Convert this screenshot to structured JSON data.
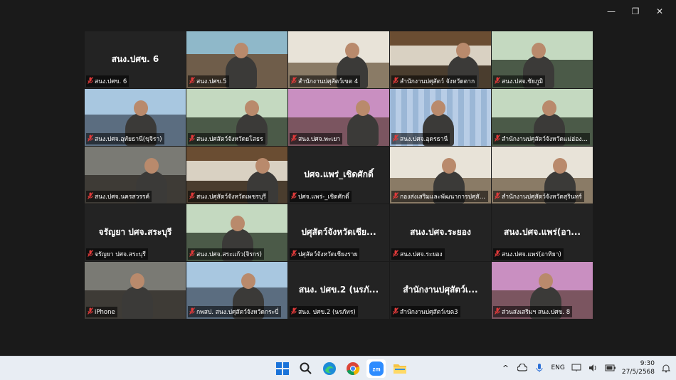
{
  "window": {
    "controls": {
      "minimize": "—",
      "restore": "❐",
      "close": "✕"
    }
  },
  "tiles": [
    {
      "big": "สนง.ปศข. 6",
      "label": "สนง.ปศข. 6",
      "scene": ""
    },
    {
      "big": "",
      "label": "สนง.ปศข.5",
      "scene": "scene-room"
    },
    {
      "big": "",
      "label": "สำนักงานปศุสัตว์เขต 4",
      "scene": "scene-office"
    },
    {
      "big": "",
      "label": "สำนักงานปศุสัตว์ จังหวัดตาก",
      "scene": "scene-board"
    },
    {
      "big": "",
      "label": "สนง.ปสจ.ชัยภูมิ",
      "scene": "scene-green"
    },
    {
      "big": "",
      "label": "สนง.ปศจ.อุทัยธานี(ขุจิรา)",
      "scene": "scene-blue"
    },
    {
      "big": "",
      "label": "สนง.ปศสัตว์จังหวัดยโสธร",
      "scene": "scene-green"
    },
    {
      "big": "",
      "label": "สนง.ปศจ.พะเยา",
      "scene": "scene-purple"
    },
    {
      "big": "",
      "label": "สนง.ปศจ.อุดรธานี",
      "scene": "scene-curtain"
    },
    {
      "big": "",
      "label": "สำนักงานปศุสัตว์จังหวัดแม่ฮ่องส...",
      "scene": "scene-green"
    },
    {
      "big": "",
      "label": "สนง.ปศจ.นครสวรรค์",
      "scene": "scene-dark"
    },
    {
      "big": "",
      "label": "สนง.ปศุสัตว์จังหวัดเพชรบุรี",
      "scene": "scene-board"
    },
    {
      "big": "ปศจ.แพร่_เชิดศักดิ์",
      "label": "ปศจ.แพร่-_เชิดศักดิ์",
      "scene": ""
    },
    {
      "big": "",
      "label": "กองส่งเสริมและพัฒนาการปศุสัตว...",
      "scene": "scene-office",
      "active": true
    },
    {
      "big": "",
      "label": "สำนักงานปศุสัตว์จังหวัดสุรินทร์",
      "scene": "scene-office"
    },
    {
      "big": "จรัญยา ปศจ.สระบุรี",
      "label": "จรัญยา ปศจ.สระบุรี",
      "scene": ""
    },
    {
      "big": "",
      "label": "สนง.ปศจ.สระแก้ว(จิรกร)",
      "scene": "scene-green"
    },
    {
      "big": "ปศุสัตว์จังหวัดเชีย...",
      "label": "ปศุสัตว์จังหวัดเชียงราย",
      "scene": ""
    },
    {
      "big": "สนง.ปศจ.ระยอง",
      "label": "สนง.ปศจ.ระยอง",
      "scene": ""
    },
    {
      "big": "สนง.ปศจ.แพร่(อา...",
      "label": "สนง.ปศจ.แพร่(อาทิยา)",
      "scene": ""
    },
    {
      "big": "",
      "label": "iPhone",
      "scene": "scene-dark"
    },
    {
      "big": "",
      "label": "กพสป. สนง.ปศุสัตว์จังหวัดกระบี่",
      "scene": "scene-blue"
    },
    {
      "big": "สนง. ปศข.2 (นรภั...",
      "label": "สนง. ปศข.2 (นรภัทร)",
      "scene": ""
    },
    {
      "big": "สำนักงานปศุสัตว์เ...",
      "label": "สำนักงานปศุสัตว์เขต3",
      "scene": ""
    },
    {
      "big": "",
      "label": "ส่วนส่งเสริมฯ สนง.ปศข. 8",
      "scene": "scene-purple"
    }
  ],
  "taskbar": {
    "apps": [
      {
        "name": "start",
        "glyph": "⊞"
      },
      {
        "name": "search",
        "glyph": "⌕"
      },
      {
        "name": "edge",
        "glyph": "e"
      },
      {
        "name": "chrome",
        "glyph": "◉"
      },
      {
        "name": "zoom",
        "glyph": "zm"
      },
      {
        "name": "explorer",
        "glyph": "▬"
      }
    ],
    "tray": {
      "chevron": "^",
      "lang": "ENG",
      "time": "9:30",
      "date": "27/5/2568"
    }
  }
}
